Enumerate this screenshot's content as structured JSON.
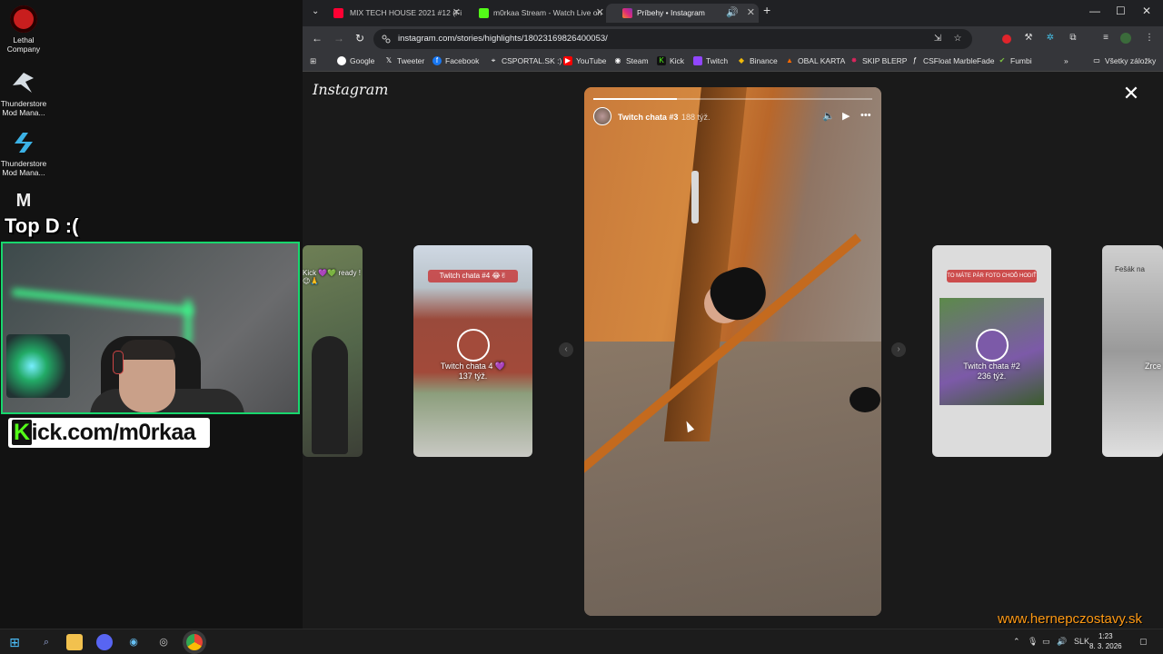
{
  "desktop": {
    "icons": [
      {
        "label": "Lethal Company",
        "color": "#c81e1e"
      },
      {
        "label": "Thunderstore Mod Mana...",
        "color": "#cfd8e0"
      },
      {
        "label": "Thunderstore Mod Mana...",
        "color": "#3bb2e6"
      },
      {
        "label": "M",
        "color": "#ffffff"
      }
    ],
    "overlay_text": "Top D :(",
    "kick_banner": {
      "k": "K",
      "rest": "ick.com/m0rkaa"
    }
  },
  "browser": {
    "tabs": [
      {
        "title": "MIX TECH HOUSE 2021 #12 (Fi",
        "icon_color": "#ff0033",
        "audio": false
      },
      {
        "title": "m0rkaa Stream - Watch Live on",
        "icon_color": "#53fc18",
        "audio": false
      },
      {
        "title": "Príbehy • Instagram",
        "icon_color": "#e1306c",
        "audio": true
      }
    ],
    "new_tab": "+",
    "url": "instagram.com/stories/highlights/18023169826400053/",
    "bookmarks": [
      {
        "label": "Google",
        "color": "#4285f4"
      },
      {
        "label": "Tweeter",
        "color": "#000000"
      },
      {
        "label": "Facebook",
        "color": "#1877f2"
      },
      {
        "label": "CSPORTAL.SK :)",
        "color": "#7a7a7a"
      },
      {
        "label": "YouTube",
        "color": "#ff0000"
      },
      {
        "label": "Steam",
        "color": "#1b2838"
      },
      {
        "label": "Kick",
        "color": "#53fc18"
      },
      {
        "label": "Twitch",
        "color": "#9146ff"
      },
      {
        "label": "Binance",
        "color": "#f0b90b"
      },
      {
        "label": "OBAL KARTA",
        "color": "#ff6a00"
      },
      {
        "label": "SKIP BLERP",
        "color": "#e0245e"
      },
      {
        "label": "CSFloat MarbleFade",
        "color": "#555555"
      },
      {
        "label": "Fumbi",
        "color": "#7cc242"
      }
    ],
    "all_bookmarks": "Všetky záložky"
  },
  "instagram": {
    "logo": "Instagram",
    "left_card_text": "Kick 💜💚 ready ! 😉🙏",
    "cards": [
      {
        "title": "Twitch chata 4 💜",
        "age": "137 týž.",
        "badge": "Twitch chata #4 😂✌"
      },
      {
        "title": "Twitch chata #2",
        "age": "236 týž.",
        "badge": "TO MÁTE PÁR FOTO CHOĎ HODIŤ"
      },
      {
        "title": "Zrce",
        "age": "",
        "badge": "Fešák na"
      }
    ],
    "story": {
      "name": "Twitch chata #3",
      "age": "188 týž.",
      "progress": 0.3
    }
  },
  "watermark": "www.hernepczostavy.sk",
  "taskbar": {
    "language": "SLK",
    "time": "1:23",
    "date": "8. 3. 2026"
  }
}
